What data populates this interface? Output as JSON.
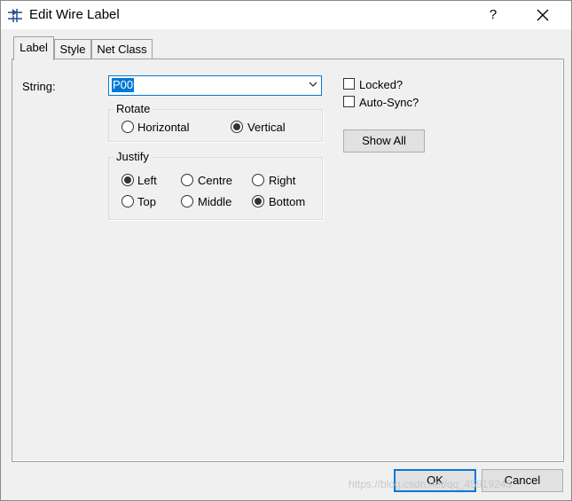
{
  "window": {
    "title": "Edit Wire Label",
    "help_label": "?",
    "close_icon": "close-x-icon",
    "app_icon": "diode-wire-icon"
  },
  "tabs": [
    {
      "label": "Label",
      "active": true
    },
    {
      "label": "Style",
      "active": false
    },
    {
      "label": "Net Class",
      "active": false
    }
  ],
  "label_tab": {
    "string_label": "String:",
    "string_value": "P00",
    "rotate": {
      "title": "Rotate",
      "options": [
        "Horizontal",
        "Vertical"
      ],
      "selected": "Vertical"
    },
    "justify": {
      "title": "Justify",
      "options": [
        "Left",
        "Centre",
        "Right",
        "Top",
        "Middle",
        "Bottom"
      ],
      "selected": [
        "Left",
        "Bottom"
      ]
    },
    "locked_label": "Locked?",
    "locked_checked": false,
    "autosync_label": "Auto-Sync?",
    "autosync_checked": false,
    "show_all_label": "Show All"
  },
  "footer": {
    "ok_label": "OK",
    "cancel_label": "Cancel"
  },
  "watermark": "https://blog.csdn.net/qq_45919245"
}
